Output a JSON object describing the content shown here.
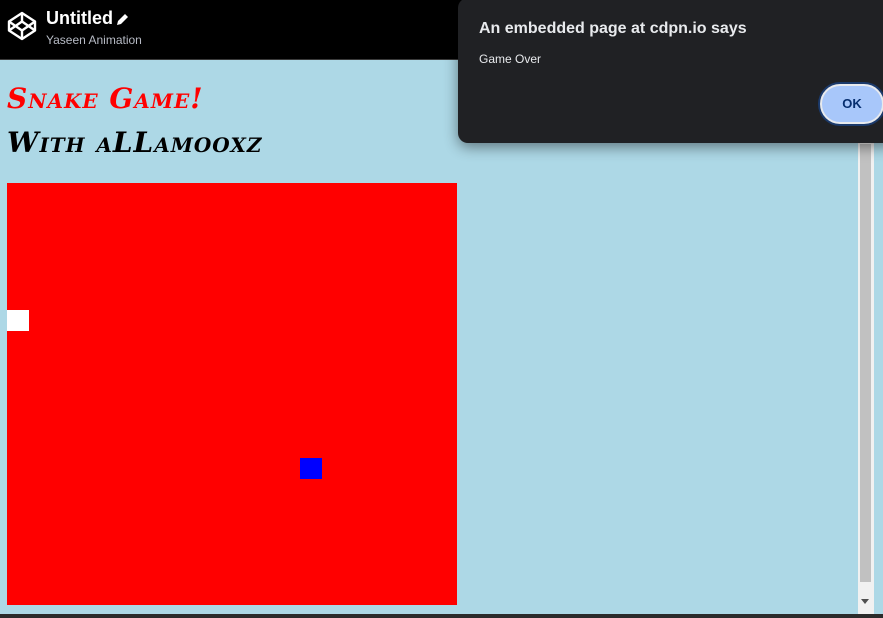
{
  "topbar": {
    "title": "Untitled",
    "subtitle": "Yaseen Animation",
    "logo_icon": "codepen-logo-icon",
    "edit_icon": "pencil-icon"
  },
  "page": {
    "heading_1": "Snake Game!",
    "heading_2": "With aLLamooxz",
    "heading_1_color": "#ff0000",
    "heading_2_color": "#000000",
    "background_color": "#add8e6"
  },
  "game": {
    "board_color": "#ff0000",
    "snake_color": "#ffffff",
    "food_color": "#0000ff"
  },
  "dialog": {
    "title": "An embedded page at cdpn.io says",
    "message": "Game Over",
    "ok_label": "OK",
    "button_color": "#a8c7fa"
  }
}
